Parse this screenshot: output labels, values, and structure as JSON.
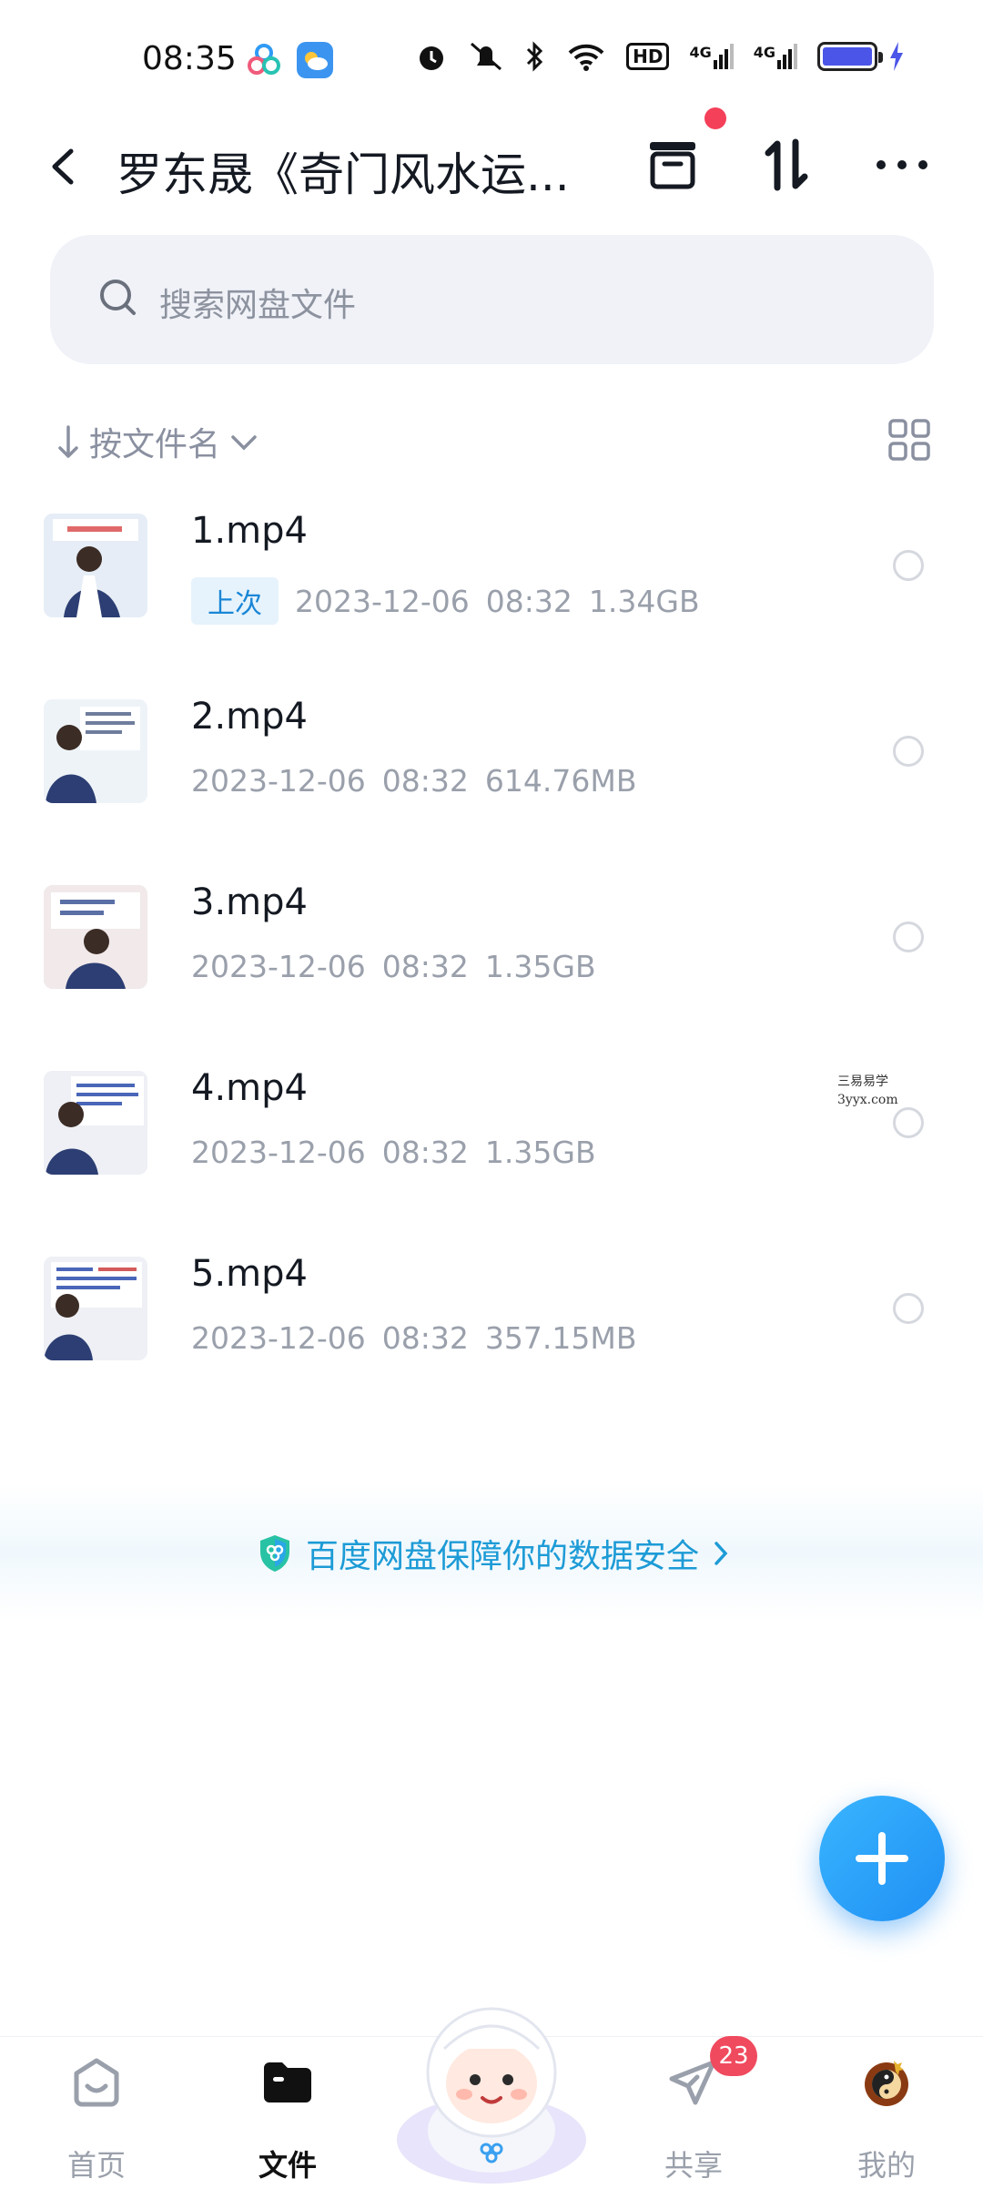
{
  "status_bar": {
    "time": "08:35",
    "network_1": "4G",
    "network_2": "4G",
    "hd_label": "HD"
  },
  "header": {
    "title": "罗东晟《奇门风水运...",
    "notification_dot_color": "#f5405a"
  },
  "search": {
    "placeholder": "搜索网盘文件"
  },
  "sort": {
    "label": "按文件名"
  },
  "files": [
    {
      "name": "1.mp4",
      "badge": "上次",
      "date": "2023-12-06",
      "time": "08:32",
      "size": "1.34GB"
    },
    {
      "name": "2.mp4",
      "badge": "",
      "date": "2023-12-06",
      "time": "08:32",
      "size": "614.76MB"
    },
    {
      "name": "3.mp4",
      "badge": "",
      "date": "2023-12-06",
      "time": "08:32",
      "size": "1.35GB"
    },
    {
      "name": "4.mp4",
      "badge": "",
      "date": "2023-12-06",
      "time": "08:32",
      "size": "1.35GB"
    },
    {
      "name": "5.mp4",
      "badge": "",
      "date": "2023-12-06",
      "time": "08:32",
      "size": "357.15MB"
    }
  ],
  "watermark": {
    "line1": "三易易学",
    "line2": "3yyx.com"
  },
  "banner": {
    "text": "百度网盘保障你的数据安全",
    "color": "#1d9bd6"
  },
  "nav": {
    "home": "首页",
    "files": "文件",
    "share": "共享",
    "share_count": "23",
    "mine": "我的"
  },
  "colors": {
    "accent": "#1f8ff3",
    "badge_bg": "#e6f3fc",
    "badge_text": "#1a86d6"
  }
}
